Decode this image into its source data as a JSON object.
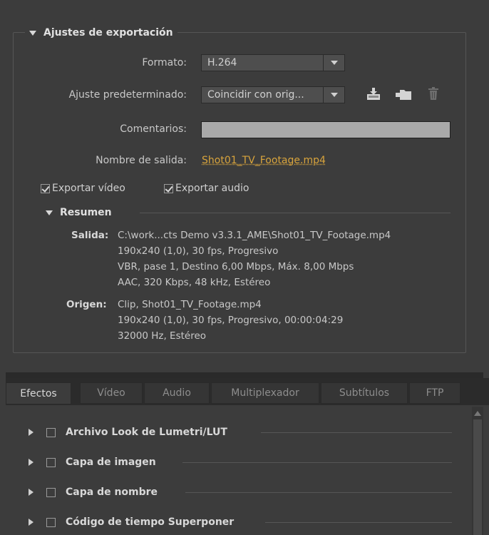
{
  "export_settings": {
    "title": "Ajustes de exportación",
    "format_label": "Formato:",
    "format_value": "H.264",
    "preset_label": "Ajuste predeterminado:",
    "preset_value": "Coincidir con orig...",
    "comments_label": "Comentarios:",
    "comments_value": "",
    "output_name_label": "Nombre de salida:",
    "output_name_value": "Shot01_TV_Footage.mp4",
    "export_video_label": "Exportar vídeo",
    "export_video_checked": true,
    "export_audio_label": "Exportar audio",
    "export_audio_checked": true,
    "icons": [
      "save-preset-icon",
      "import-preset-icon",
      "delete-preset-icon"
    ]
  },
  "summary": {
    "title": "Resumen",
    "output_key": "Salida:",
    "output_lines": [
      "C:\\work...cts Demo v3.3.1_AME\\Shot01_TV_Footage.mp4",
      "190x240 (1,0), 30 fps, Progresivo",
      "VBR, pase 1, Destino 6,00 Mbps, Máx. 8,00 Mbps",
      "AAC, 320 Kbps, 48 kHz, Estéreo"
    ],
    "source_key": "Origen:",
    "source_lines": [
      "Clip, Shot01_TV_Footage.mp4",
      "190x240 (1,0), 30 fps, Progresivo, 00:00:04:29",
      "32000 Hz, Estéreo"
    ]
  },
  "tabs": [
    {
      "label": "Efectos",
      "active": true
    },
    {
      "label": "Vídeo",
      "active": false
    },
    {
      "label": "Audio",
      "active": false
    },
    {
      "label": "Multiplexador",
      "active": false
    },
    {
      "label": "Subtítulos",
      "active": false
    },
    {
      "label": "FTP",
      "active": false
    }
  ],
  "effects": [
    {
      "label": "Archivo Look de Lumetri/LUT",
      "checked": false
    },
    {
      "label": "Capa de imagen",
      "checked": false
    },
    {
      "label": "Capa de nombre",
      "checked": false
    },
    {
      "label": "Código de tiempo Superponer",
      "checked": false
    }
  ],
  "colors": {
    "background": "#3c3c3c",
    "link": "#d8a43c",
    "text": "#c8c8c8"
  }
}
